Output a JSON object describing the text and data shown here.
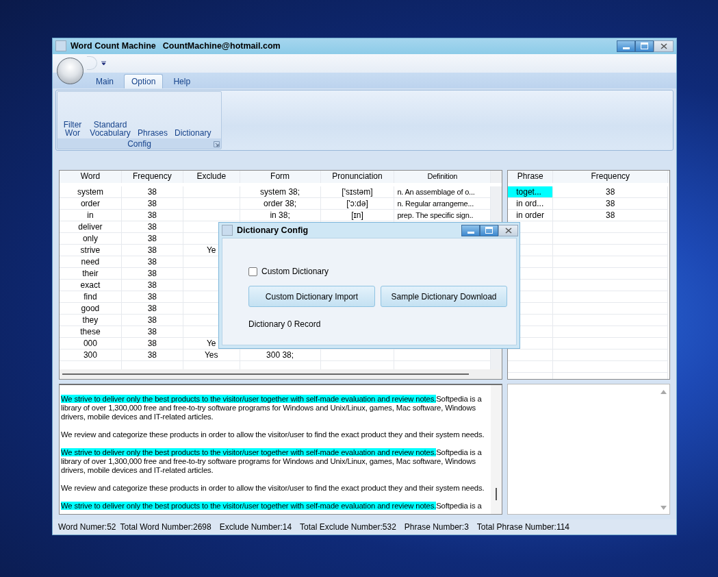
{
  "window": {
    "title": "Word Count Machine",
    "email": "CountMachine@hotmail.com"
  },
  "tabs": [
    {
      "label": "Main",
      "selected": false
    },
    {
      "label": "Option",
      "selected": true
    },
    {
      "label": "Help",
      "selected": false
    }
  ],
  "ribbon_group": {
    "title": "Config",
    "buttons": [
      "Filter Wor",
      "Standard Vocabulary",
      "Phrases",
      "Dictionary"
    ]
  },
  "word_table": {
    "columns": [
      "Word",
      "Frequency",
      "Exclude",
      "Form",
      "Pronunciation",
      "Definition"
    ],
    "rows": [
      {
        "cells": [
          "system",
          "38",
          "",
          "system 38;",
          "['sɪstəm]",
          "n.  An assemblage of o..."
        ]
      },
      {
        "cells": [
          "order",
          "38",
          "",
          "order 38;",
          "['ɔ:də]",
          "n.  Regular arrangeme..."
        ]
      },
      {
        "cells": [
          "in",
          "38",
          "",
          "in 38;",
          "[ɪn]",
          "prep.  The specific sign.."
        ]
      },
      {
        "cells": [
          "deliver",
          "38"
        ]
      },
      {
        "cells": [
          "only",
          "38"
        ]
      },
      {
        "cells": [
          "strive",
          "38",
          "Ye"
        ]
      },
      {
        "cells": [
          "need",
          "38"
        ]
      },
      {
        "cells": [
          "their",
          "38"
        ]
      },
      {
        "cells": [
          "exact",
          "38"
        ]
      },
      {
        "cells": [
          "find",
          "38"
        ]
      },
      {
        "cells": [
          "good",
          "38"
        ]
      },
      {
        "cells": [
          "they",
          "38"
        ]
      },
      {
        "cells": [
          "these",
          "38"
        ]
      },
      {
        "cells": [
          "000",
          "38",
          "Ye"
        ]
      },
      {
        "cells": [
          "300",
          "38",
          "Yes",
          "300 38;"
        ]
      }
    ]
  },
  "phrase_table": {
    "columns": [
      "Phrase",
      "Frequency"
    ],
    "rows": [
      {
        "phrase": "toget...",
        "frequency": "38",
        "selected": true
      },
      {
        "phrase": "in ord...",
        "frequency": "38",
        "selected": false
      },
      {
        "phrase": "in order",
        "frequency": "38",
        "selected": false
      }
    ]
  },
  "text_pane": {
    "paragraphs": [
      {
        "highlight": "We strive to deliver only the best products to the visitor/user together with self-made evaluation and review notes.",
        "text": "Softpedia is a library of over 1,300,000 free and free-to-try software programs for Windows and Unix/Linux, games, Mac software, Windows drivers, mobile devices and IT-related articles."
      },
      {
        "text": "We review and categorize these products in order to allow the visitor/user to find the exact product they and their system needs."
      },
      {
        "highlight": "We strive to deliver only the best products to the visitor/user together with self-made evaluation and review notes.",
        "text": "Softpedia is a library of over 1,300,000 free and free-to-try software programs for Windows and Unix/Linux, games, Mac software, Windows drivers, mobile devices and IT-related articles."
      },
      {
        "text": "We review and categorize these products in order to allow the visitor/user to find the exact product they and their system needs."
      },
      {
        "highlight": "We strive to deliver only the best products to the visitor/user together with self-made evaluation and review notes.",
        "text": "Softpedia is a"
      }
    ]
  },
  "status_bar": [
    "Word Numer:52",
    "Total Word Number:2698",
    "Exclude Number:14",
    "Total Exclude Number:532",
    "Phrase Number:3",
    "Total Phrase Number:114"
  ],
  "dialog": {
    "title": "Dictionary Config",
    "checkbox": {
      "label": "Custom Dictionary",
      "checked": false
    },
    "buttons": [
      "Custom Dictionary Import",
      "Sample Dictionary Download"
    ],
    "record": "Dictionary 0 Record"
  }
}
